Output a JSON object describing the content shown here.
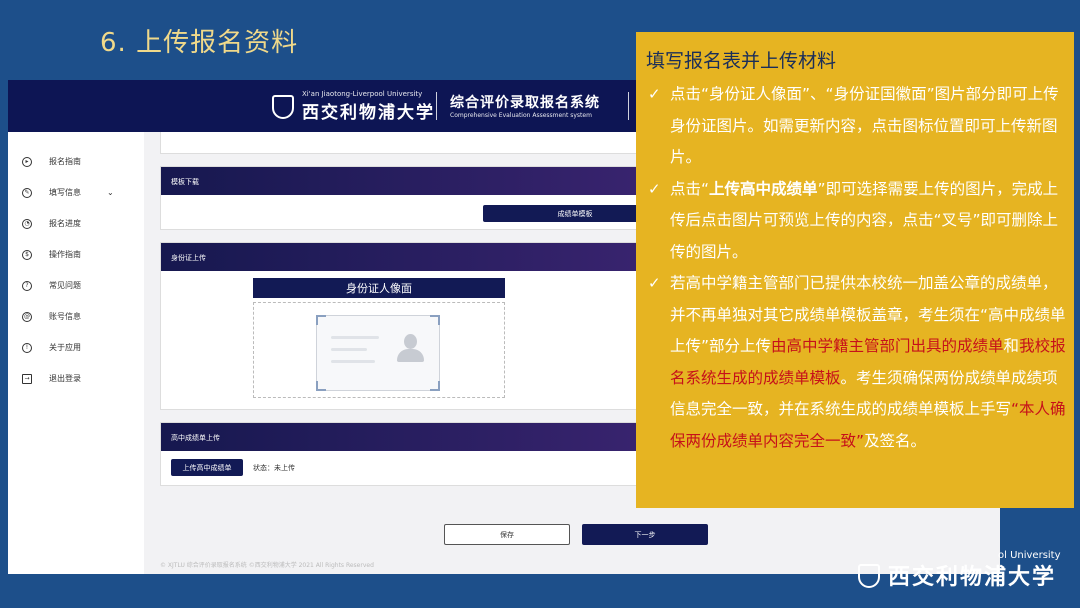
{
  "slide": {
    "title": "6. 上传报名资料"
  },
  "header": {
    "university_en": "Xi'an Jiaotong-Liverpool University",
    "university_cn": "西交利物浦大学",
    "system_cn": "综合评价录取报名系统",
    "system_en": "Comprehensive Evaluation Assessment system"
  },
  "sidebar": {
    "items": [
      {
        "label": "报名指南",
        "icon": "guide-icon"
      },
      {
        "label": "填写信息",
        "icon": "edit-icon",
        "expandable": true
      },
      {
        "label": "报名进度",
        "icon": "progress-icon"
      },
      {
        "label": "操作指南",
        "icon": "operation-icon"
      },
      {
        "label": "常见问题",
        "icon": "help-icon"
      },
      {
        "label": "账号信息",
        "icon": "account-icon"
      },
      {
        "label": "关于应用",
        "icon": "info-icon"
      },
      {
        "label": "退出登录",
        "icon": "logout-icon"
      }
    ]
  },
  "sections": {
    "template": {
      "title": "模板下载",
      "button": "成绩单模板"
    },
    "idcard": {
      "title": "身份证上传",
      "front_label": "身份证人像面"
    },
    "transcript": {
      "title": "高中成绩单上传",
      "button": "上传高中成绩单",
      "status": "状态：未上传"
    }
  },
  "footer": {
    "save": "保存",
    "next": "下一步",
    "copyright": "© XJTLU 综合评价录取报名系统 ©西交利物浦大学 2021 All Rights Reserved"
  },
  "callout": {
    "title": "填写报名表并上传材料",
    "p1": "点击“身份证人像面”、“身份证国徽面”图片部分即可上传身份证图片。如需更新内容，点击图标位置即可上传新图片。",
    "p2_a": "点击“",
    "p2_b": "上传高中成绩单",
    "p2_c": "”即可选择需要上传的图片，完成上传后点击图片可预览上传的内容，点击“叉号”即可删除上传的图片。",
    "p3_a": "若高中学籍主管部门已提供本校统一加盖公章的成绩单，并不再单独对其它成绩单模板盖章，考生须在“高中成绩单上传”部分上传",
    "p3_red1": "由高中学籍主管部门出具的成绩单",
    "p3_and": "和",
    "p3_red2": "我校报名系统生成的成绩单模板",
    "p3_b": "。考生须确保两份成绩单成绩项信息完全一致，并在系统生成的成绩单模板上手写",
    "p3_red3": "“本人确保两份成绩单内容完全一致”",
    "p3_c": "及签名。"
  },
  "bottom_logo": {
    "en": "ol University",
    "cn": "西交利物浦大学"
  },
  "colors": {
    "navy": "#0d1554",
    "gold": "#e6b422",
    "slide_bg": "#1d4f8a",
    "red": "#c6111a"
  }
}
